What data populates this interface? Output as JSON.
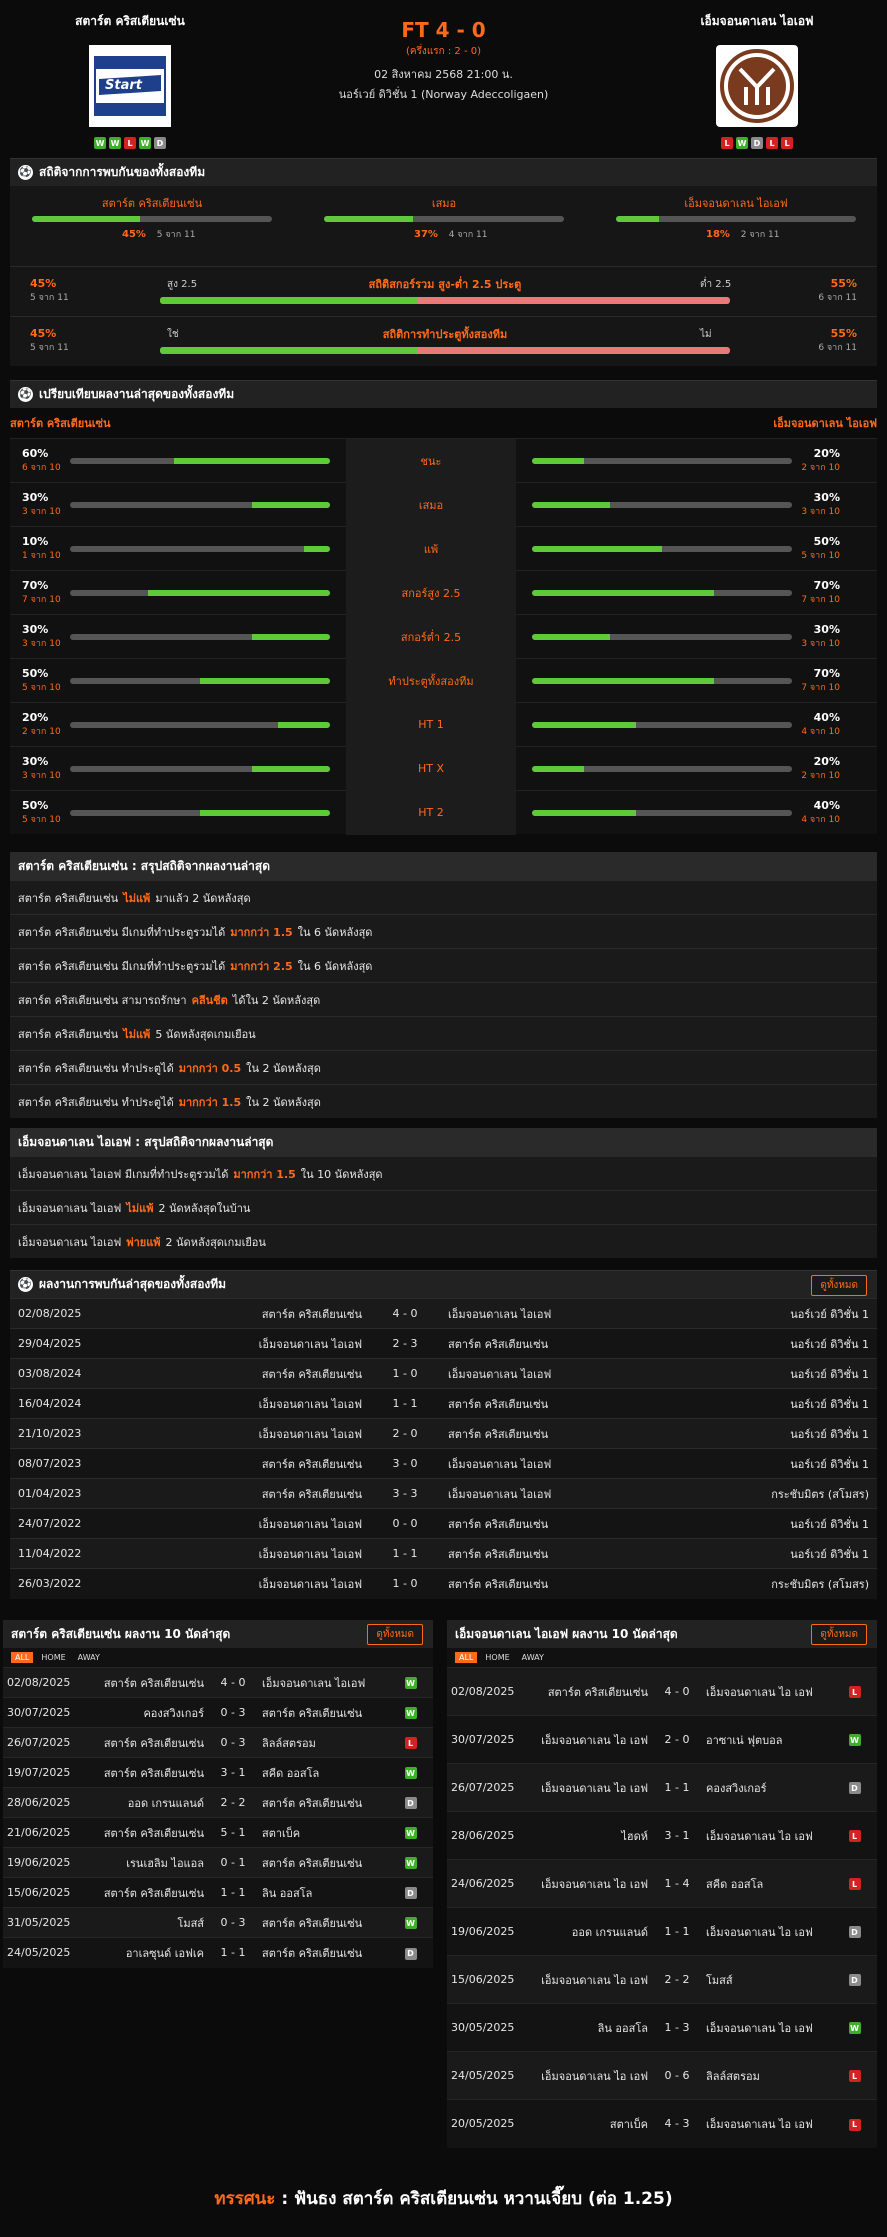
{
  "header": {
    "home_name": "สตาร์ต คริสเตียนเซ่น",
    "away_name": "เอ็มจอนดาเลน ไอเอฟ",
    "score": "FT 4 - 0",
    "ht_score": "(ครึ่งแรก : 2 - 0)",
    "datetime": "02 สิงหาคม 2568 21:00 น.",
    "league": "นอร์เวย์ ดิวิชั่น 1 (Norway Adeccoligaen)",
    "home_logo_text": "Start",
    "away_logo_text": "MIF",
    "home_form": [
      "W",
      "W",
      "L",
      "W",
      "D"
    ],
    "away_form": [
      "L",
      "W",
      "D",
      "L",
      "L"
    ]
  },
  "h2h": {
    "title": "สถิติจากการพบกันของทั้งสองทีม",
    "items": [
      {
        "label": "สตาร์ต คริสเตียนเซ่น",
        "pct": "45%",
        "count": "5 จาก 11",
        "fill": 0.45
      },
      {
        "label": "เสมอ",
        "pct": "37%",
        "count": "4 จาก 11",
        "fill": 0.37
      },
      {
        "label": "เอ็มจอนดาเลน ไอเอฟ",
        "pct": "18%",
        "count": "2 จาก 11",
        "fill": 0.18
      }
    ],
    "ou": [
      {
        "lpct": "45%",
        "lcount": "5 จาก 11",
        "title": "สถิติสกอร์รวม สูง-ต่ำ 2.5 ประตู",
        "ltag": "สูง 2.5",
        "rtag": "ต่ำ 2.5",
        "rpct": "55%",
        "rcount": "6 จาก 11",
        "fill": 0.45
      },
      {
        "lpct": "45%",
        "lcount": "5 จาก 11",
        "title": "สถิติการทำประตูทั้งสองทีม",
        "ltag": "ใช่",
        "rtag": "ไม่",
        "rpct": "55%",
        "rcount": "6 จาก 11",
        "fill": 0.45
      }
    ]
  },
  "compare": {
    "title": "เปรียบเทียบผลงานล่าสุดของทั้งสองทีม",
    "home": "สตาร์ต คริสเตียนเซ่น",
    "away": "เอ็มจอนดาเลน ไอเอฟ",
    "rows": [
      {
        "label": "ชนะ",
        "lp": "60%",
        "lc": "6 จาก 10",
        "lf": 0.6,
        "rp": "20%",
        "rc": "2 จาก 10",
        "rf": 0.2
      },
      {
        "label": "เสมอ",
        "lp": "30%",
        "lc": "3 จาก 10",
        "lf": 0.3,
        "rp": "30%",
        "rc": "3 จาก 10",
        "rf": 0.3
      },
      {
        "label": "แพ้",
        "lp": "10%",
        "lc": "1 จาก 10",
        "lf": 0.1,
        "rp": "50%",
        "rc": "5 จาก 10",
        "rf": 0.5
      },
      {
        "label": "สกอร์สูง 2.5",
        "lp": "70%",
        "lc": "7 จาก 10",
        "lf": 0.7,
        "rp": "70%",
        "rc": "7 จาก 10",
        "rf": 0.7
      },
      {
        "label": "สกอร์ต่ำ 2.5",
        "lp": "30%",
        "lc": "3 จาก 10",
        "lf": 0.3,
        "rp": "30%",
        "rc": "3 จาก 10",
        "rf": 0.3
      },
      {
        "label": "ทำประตูทั้งสองทีม",
        "lp": "50%",
        "lc": "5 จาก 10",
        "lf": 0.5,
        "rp": "70%",
        "rc": "7 จาก 10",
        "rf": 0.7
      },
      {
        "label": "HT 1",
        "lp": "20%",
        "lc": "2 จาก 10",
        "lf": 0.2,
        "rp": "40%",
        "rc": "4 จาก 10",
        "rf": 0.4
      },
      {
        "label": "HT X",
        "lp": "30%",
        "lc": "3 จาก 10",
        "lf": 0.3,
        "rp": "20%",
        "rc": "2 จาก 10",
        "rf": 0.2
      },
      {
        "label": "HT 2",
        "lp": "50%",
        "lc": "5 จาก 10",
        "lf": 0.5,
        "rp": "40%",
        "rc": "4 จาก 10",
        "rf": 0.4
      }
    ]
  },
  "home_summary": {
    "title": "สตาร์ต คริสเตียนเซ่น : สรุปสถิติจากผลงานล่าสุด",
    "rows": [
      [
        "สตาร์ต คริสเตียนเซ่น",
        "ไม่แพ้",
        "มาแล้ว 2 นัดหลังสุด"
      ],
      [
        "สตาร์ต คริสเตียนเซ่น มีเกมที่ทำประตูรวมได้",
        "มากกว่า 1.5",
        "ใน 6 นัดหลังสุด"
      ],
      [
        "สตาร์ต คริสเตียนเซ่น มีเกมที่ทำประตูรวมได้",
        "มากกว่า 2.5",
        "ใน 6 นัดหลังสุด"
      ],
      [
        "สตาร์ต คริสเตียนเซ่น สามารถรักษา",
        "คลีนชีต",
        "ได้ใน 2 นัดหลังสุด"
      ],
      [
        "สตาร์ต คริสเตียนเซ่น",
        "ไม่แพ้",
        "5 นัดหลังสุดเกมเยือน"
      ],
      [
        "สตาร์ต คริสเตียนเซ่น ทำประตูได้",
        "มากกว่า 0.5",
        "ใน 2 นัดหลังสุด"
      ],
      [
        "สตาร์ต คริสเตียนเซ่น ทำประตูได้",
        "มากกว่า 1.5",
        "ใน 2 นัดหลังสุด"
      ]
    ]
  },
  "away_summary": {
    "title": "เอ็มจอนดาเลน ไอเอฟ : สรุปสถิติจากผลงานล่าสุด",
    "rows": [
      [
        "เอ็มจอนดาเลน ไอเอฟ มีเกมที่ทำประตูรวมได้",
        "มากกว่า 1.5",
        "ใน 10 นัดหลังสุด"
      ],
      [
        "เอ็มจอนดาเลน ไอเอฟ",
        "ไม่แพ้",
        "2 นัดหลังสุดในบ้าน"
      ],
      [
        "เอ็มจอนดาเลน ไอเอฟ",
        "พ่ายแพ้",
        "2 นัดหลังสุดเกมเยือน"
      ]
    ]
  },
  "results": {
    "title": "ผลงานการพบกันล่าสุดของทั้งสองทีม",
    "button": "ดูทั้งหมด",
    "rows": [
      [
        "02/08/2025",
        "สตาร์ต คริสเตียนเซ่น",
        "4 - 0",
        "เอ็มจอนดาเลน ไอเอฟ",
        "นอร์เวย์ ดิวิชั่น 1"
      ],
      [
        "29/04/2025",
        "เอ็มจอนดาเลน ไอเอฟ",
        "2 - 3",
        "สตาร์ต คริสเตียนเซ่น",
        "นอร์เวย์ ดิวิชั่น 1"
      ],
      [
        "03/08/2024",
        "สตาร์ต คริสเตียนเซ่น",
        "1 - 0",
        "เอ็มจอนดาเลน ไอเอฟ",
        "นอร์เวย์ ดิวิชั่น 1"
      ],
      [
        "16/04/2024",
        "เอ็มจอนดาเลน ไอเอฟ",
        "1 - 1",
        "สตาร์ต คริสเตียนเซ่น",
        "นอร์เวย์ ดิวิชั่น 1"
      ],
      [
        "21/10/2023",
        "เอ็มจอนดาเลน ไอเอฟ",
        "2 - 0",
        "สตาร์ต คริสเตียนเซ่น",
        "นอร์เวย์ ดิวิชั่น 1"
      ],
      [
        "08/07/2023",
        "สตาร์ต คริสเตียนเซ่น",
        "3 - 0",
        "เอ็มจอนดาเลน ไอเอฟ",
        "นอร์เวย์ ดิวิชั่น 1"
      ],
      [
        "01/04/2023",
        "สตาร์ต คริสเตียนเซ่น",
        "3 - 3",
        "เอ็มจอนดาเลน ไอเอฟ",
        "กระชับมิตร (สโมสร)"
      ],
      [
        "24/07/2022",
        "เอ็มจอนดาเลน ไอเอฟ",
        "0 - 0",
        "สตาร์ต คริสเตียนเซ่น",
        "นอร์เวย์ ดิวิชั่น 1"
      ],
      [
        "11/04/2022",
        "เอ็มจอนดาเลน ไอเอฟ",
        "1 - 1",
        "สตาร์ต คริสเตียนเซ่น",
        "นอร์เวย์ ดิวิชั่น 1"
      ],
      [
        "26/03/2022",
        "เอ็มจอนดาเลน ไอเอฟ",
        "1 - 0",
        "สตาร์ต คริสเตียนเซ่น",
        "กระชับมิตร (สโมสร)"
      ]
    ]
  },
  "last10_home": {
    "title": "สตาร์ต คริสเตียนเซ่น ผลงาน 10 นัดล่าสุด",
    "button": "ดูทั้งหมด",
    "tabs": [
      "ALL",
      "HOME",
      "AWAY"
    ],
    "rows": [
      [
        "02/08/2025",
        "สตาร์ต คริสเตียนเซ่น",
        "4 - 0",
        "เอ็มจอนดาเลน ไอเอฟ",
        "W"
      ],
      [
        "30/07/2025",
        "คองสวิงเกอร์",
        "0 - 3",
        "สตาร์ต คริสเตียนเซ่น",
        "W"
      ],
      [
        "26/07/2025",
        "สตาร์ต คริสเตียนเซ่น",
        "0 - 3",
        "ลิลล์สตรอม",
        "L"
      ],
      [
        "19/07/2025",
        "สตาร์ต คริสเตียนเซ่น",
        "3 - 1",
        "สคีด ออสโล",
        "W"
      ],
      [
        "28/06/2025",
        "ออด เกรนแลนด์",
        "2 - 2",
        "สตาร์ต คริสเตียนเซ่น",
        "D"
      ],
      [
        "21/06/2025",
        "สตาร์ต คริสเตียนเซ่น",
        "5 - 1",
        "สตาเบ็ค",
        "W"
      ],
      [
        "19/06/2025",
        "เรนเฮลิม ไอแอล",
        "0 - 1",
        "สตาร์ต คริสเตียนเซ่น",
        "W"
      ],
      [
        "15/06/2025",
        "สตาร์ต คริสเตียนเซ่น",
        "1 - 1",
        "ลิน ออสโล",
        "D"
      ],
      [
        "31/05/2025",
        "โมสส์",
        "0 - 3",
        "สตาร์ต คริสเตียนเซ่น",
        "W"
      ],
      [
        "24/05/2025",
        "อาเลซุนด์ เอฟเค",
        "1 - 1",
        "สตาร์ต คริสเตียนเซ่น",
        "D"
      ]
    ]
  },
  "last10_away": {
    "title": "เอ็มจอนดาเลน ไอเอฟ ผลงาน 10 นัดล่าสุด",
    "button": "ดูทั้งหมด",
    "tabs": [
      "ALL",
      "HOME",
      "AWAY"
    ],
    "rows": [
      [
        "02/08/2025",
        "สตาร์ต คริสเตียนเซ่น",
        "4 - 0",
        "เอ็มจอนดาเลน ไอ เอฟ",
        "L"
      ],
      [
        "30/07/2025",
        "เอ็มจอนดาเลน ไอ เอฟ",
        "2 - 0",
        "อาซาเน่ ฟุตบอล",
        "W"
      ],
      [
        "26/07/2025",
        "เอ็มจอนดาเลน ไอ เอฟ",
        "1 - 1",
        "คองสวิงเกอร์",
        "D"
      ],
      [
        "28/06/2025",
        "ไฮดห์",
        "3 - 1",
        "เอ็มจอนดาเลน ไอ เอฟ",
        "L"
      ],
      [
        "24/06/2025",
        "เอ็มจอนดาเลน ไอ เอฟ",
        "1 - 4",
        "สคีด ออสโล",
        "L"
      ],
      [
        "19/06/2025",
        "ออด เกรนแลนด์",
        "1 - 1",
        "เอ็มจอนดาเลน ไอ เอฟ",
        "D"
      ],
      [
        "15/06/2025",
        "เอ็มจอนดาเลน ไอ เอฟ",
        "2 - 2",
        "โมสส์",
        "D"
      ],
      [
        "30/05/2025",
        "ลิน ออสโล",
        "1 - 3",
        "เอ็มจอนดาเลน ไอ เอฟ",
        "W"
      ],
      [
        "24/05/2025",
        "เอ็มจอนดาเลน ไอ เอฟ",
        "0 - 6",
        "ลิลล์สตรอม",
        "L"
      ],
      [
        "20/05/2025",
        "สตาเบ็ค",
        "4 - 3",
        "เอ็มจอนดาเลน ไอ เอฟ",
        "L"
      ]
    ]
  },
  "tip": {
    "label": "ทรรศนะ",
    "sep": ":",
    "text": "ฟันธง สตาร์ต คริสเตียนเซ่น หวานเจี๊ยบ (ต่อ 1.25)"
  }
}
